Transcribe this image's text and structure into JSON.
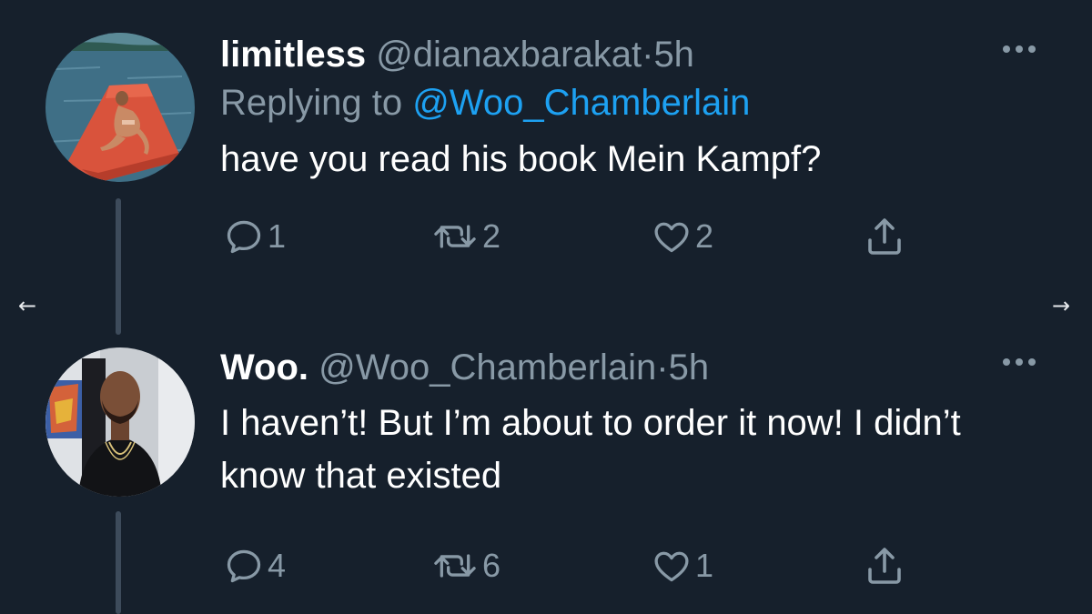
{
  "navigation": {
    "prev_icon": "←",
    "next_icon": "→"
  },
  "tweets": [
    {
      "display_name": "limitless",
      "handle": "@dianaxbarakat",
      "separator": "·",
      "time": "5h",
      "replying_prefix": "Replying to",
      "replying_to": "@Woo_Chamberlain",
      "text": "have you read his book Mein Kampf?",
      "replies": "1",
      "retweets": "2",
      "likes": "2"
    },
    {
      "display_name": "Woo.",
      "handle": "@Woo_Chamberlain",
      "separator": "·",
      "time": "5h",
      "text": "I haven’t! But I’m about to order it now! I didn’t know that existed",
      "replies": "4",
      "retweets": "6",
      "likes": "1"
    }
  ],
  "colors": {
    "background": "#16202c",
    "text_primary": "#ffffff",
    "text_secondary": "#8899a6",
    "link": "#1da1f2",
    "thread_line": "#3d4b5b"
  },
  "icons": [
    "arrow-left-icon",
    "arrow-right-icon",
    "more-icon",
    "reply-icon",
    "retweet-icon",
    "like-icon",
    "share-icon"
  ]
}
